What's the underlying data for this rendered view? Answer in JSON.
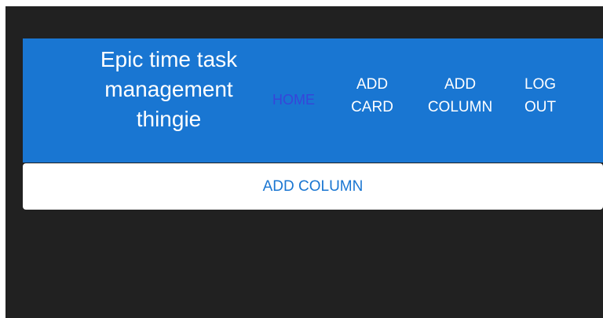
{
  "app": {
    "title": "Epic time task management thingie"
  },
  "nav": {
    "home": "HOME",
    "add_card_line1": "ADD",
    "add_card_line2": "CARD",
    "add_column_line1": "ADD",
    "add_column_line2": "COLUMN",
    "logout_line1": "LOG",
    "logout_line2": "OUT"
  },
  "main": {
    "add_column_button": "ADD COLUMN"
  },
  "colors": {
    "appbar": "#1976d2",
    "background": "#212121",
    "home_link": "#3d3ddb",
    "button_text": "#1976d2"
  }
}
